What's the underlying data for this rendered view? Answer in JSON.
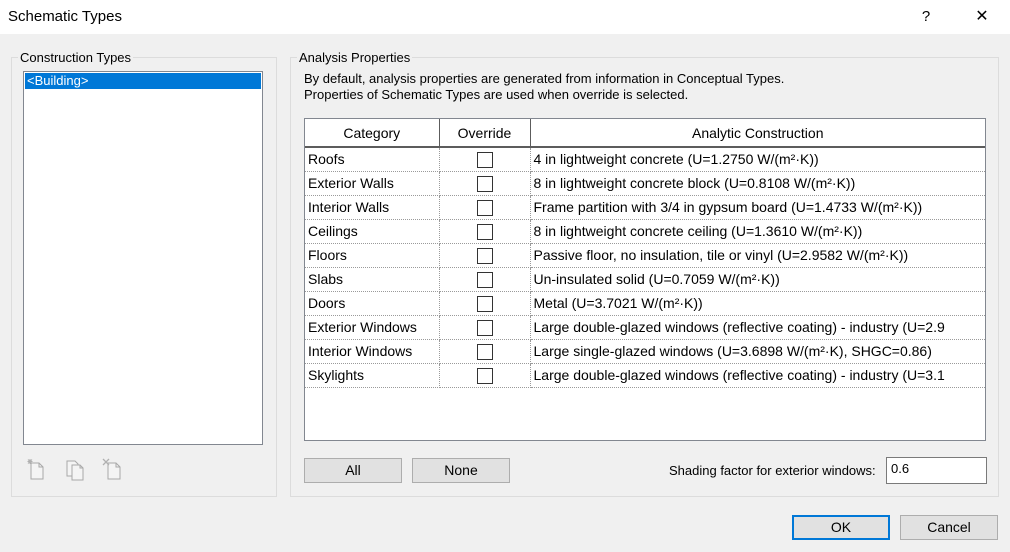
{
  "window": {
    "title": "Schematic Types",
    "help_label": "?",
    "close_label": "✕"
  },
  "construction_types": {
    "group_label": "Construction Types",
    "items": [
      "<Building>"
    ],
    "selected_index": 0,
    "toolbar_icons": [
      "new-type-icon",
      "duplicate-type-icon",
      "delete-type-icon"
    ]
  },
  "analysis": {
    "group_label": "Analysis Properties",
    "description_lines": [
      "By default, analysis properties are generated from information in Conceptual Types.",
      "Properties of Schematic Types are used when override is selected."
    ],
    "columns": [
      "Category",
      "Override",
      "Analytic Construction"
    ],
    "rows": [
      {
        "category": "Roofs",
        "override": false,
        "construction": "4 in lightweight concrete (U=1.2750 W/(m²·K))"
      },
      {
        "category": "Exterior Walls",
        "override": false,
        "construction": "8 in lightweight concrete block (U=0.8108 W/(m²·K))"
      },
      {
        "category": "Interior Walls",
        "override": false,
        "construction": "Frame partition with 3/4 in gypsum board (U=1.4733 W/(m²·K))"
      },
      {
        "category": "Ceilings",
        "override": false,
        "construction": "8 in lightweight concrete ceiling (U=1.3610 W/(m²·K))"
      },
      {
        "category": "Floors",
        "override": false,
        "construction": "Passive floor, no insulation, tile or vinyl (U=2.9582 W/(m²·K))"
      },
      {
        "category": "Slabs",
        "override": false,
        "construction": "Un-insulated solid (U=0.7059 W/(m²·K))"
      },
      {
        "category": "Doors",
        "override": false,
        "construction": "Metal (U=3.7021 W/(m²·K))"
      },
      {
        "category": "Exterior Windows",
        "override": false,
        "construction": "Large double-glazed windows (reflective coating) - industry (U=2.9"
      },
      {
        "category": "Interior Windows",
        "override": false,
        "construction": "Large single-glazed windows (U=3.6898 W/(m²·K), SHGC=0.86)"
      },
      {
        "category": "Skylights",
        "override": false,
        "construction": "Large double-glazed windows (reflective coating) - industry (U=3.1"
      }
    ],
    "all_label": "All",
    "none_label": "None",
    "shading_label": "Shading factor for exterior windows:",
    "shading_value": "0.6"
  },
  "footer": {
    "ok_label": "OK",
    "cancel_label": "Cancel"
  },
  "colors": {
    "selection": "#0078d7",
    "dialog_bg": "#f0f0f0"
  }
}
